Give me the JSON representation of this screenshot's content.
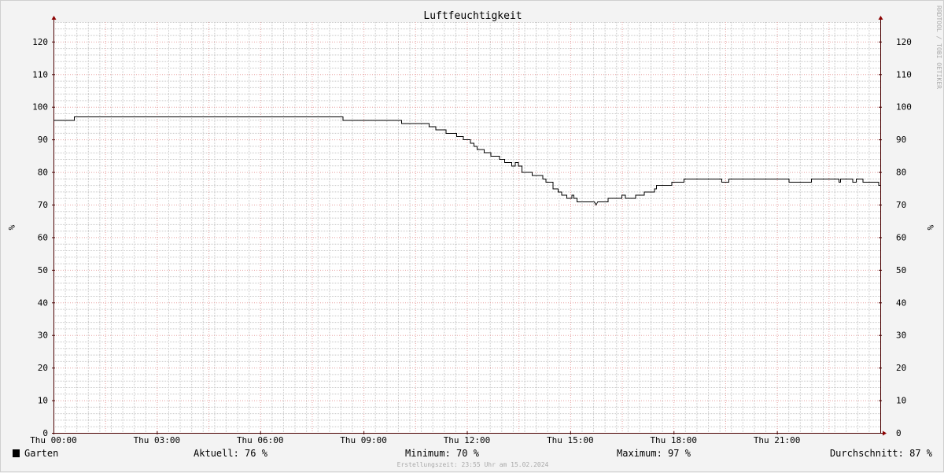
{
  "chart_data": {
    "type": "line",
    "title": "Luftfeuchtigkeit",
    "ylabel_left": "%",
    "ylabel_right": "%",
    "watermark": "RRDTOOL / TOBI OETIKER",
    "ylim": [
      0,
      126
    ],
    "y_ticks": [
      0,
      10,
      20,
      30,
      40,
      50,
      60,
      70,
      80,
      90,
      100,
      110,
      120
    ],
    "x_range_hours": [
      0,
      24
    ],
    "x_ticks": [
      {
        "hour": 0,
        "label": "Thu 00:00"
      },
      {
        "hour": 3,
        "label": "Thu 03:00"
      },
      {
        "hour": 6,
        "label": "Thu 06:00"
      },
      {
        "hour": 9,
        "label": "Thu 09:00"
      },
      {
        "hour": 12,
        "label": "Thu 12:00"
      },
      {
        "hour": 15,
        "label": "Thu 15:00"
      },
      {
        "hour": 18,
        "label": "Thu 18:00"
      },
      {
        "hour": 21,
        "label": "Thu 21:00"
      }
    ],
    "grid": true,
    "colors": {
      "background": "#f3f3f3",
      "canvas": "#ffffff",
      "major_grid": "#e8a0a0",
      "minor_grid": "#c8c8c8",
      "axis": "#4a0000",
      "line": "#000000"
    },
    "series": [
      {
        "name": "Garten",
        "color": "#000000",
        "points": [
          [
            0.0,
            96
          ],
          [
            0.6,
            96
          ],
          [
            0.6,
            97
          ],
          [
            8.4,
            97
          ],
          [
            8.4,
            96
          ],
          [
            10.1,
            96
          ],
          [
            10.1,
            95
          ],
          [
            10.9,
            95
          ],
          [
            10.9,
            94
          ],
          [
            11.1,
            94
          ],
          [
            11.1,
            93
          ],
          [
            11.4,
            93
          ],
          [
            11.4,
            92
          ],
          [
            11.7,
            92
          ],
          [
            11.7,
            91
          ],
          [
            11.9,
            91
          ],
          [
            11.9,
            90
          ],
          [
            12.1,
            90
          ],
          [
            12.1,
            89
          ],
          [
            12.2,
            89
          ],
          [
            12.2,
            88
          ],
          [
            12.3,
            88
          ],
          [
            12.3,
            87
          ],
          [
            12.5,
            87
          ],
          [
            12.5,
            86
          ],
          [
            12.7,
            86
          ],
          [
            12.7,
            85
          ],
          [
            12.95,
            85
          ],
          [
            12.95,
            84
          ],
          [
            13.1,
            84
          ],
          [
            13.1,
            83
          ],
          [
            13.3,
            83
          ],
          [
            13.3,
            82
          ],
          [
            13.4,
            82
          ],
          [
            13.4,
            83
          ],
          [
            13.5,
            83
          ],
          [
            13.5,
            82
          ],
          [
            13.6,
            82
          ],
          [
            13.6,
            80
          ],
          [
            13.9,
            80
          ],
          [
            13.9,
            79
          ],
          [
            14.2,
            79
          ],
          [
            14.2,
            78
          ],
          [
            14.3,
            78
          ],
          [
            14.3,
            77
          ],
          [
            14.5,
            77
          ],
          [
            14.5,
            75
          ],
          [
            14.65,
            75
          ],
          [
            14.65,
            74
          ],
          [
            14.75,
            74
          ],
          [
            14.75,
            73
          ],
          [
            14.9,
            73
          ],
          [
            14.9,
            72
          ],
          [
            15.05,
            72
          ],
          [
            15.05,
            73
          ],
          [
            15.1,
            73
          ],
          [
            15.1,
            72
          ],
          [
            15.2,
            72
          ],
          [
            15.2,
            71
          ],
          [
            15.7,
            71
          ],
          [
            15.75,
            70
          ],
          [
            15.8,
            71
          ],
          [
            16.1,
            71
          ],
          [
            16.1,
            72
          ],
          [
            16.5,
            72
          ],
          [
            16.5,
            73
          ],
          [
            16.6,
            73
          ],
          [
            16.6,
            72
          ],
          [
            16.9,
            72
          ],
          [
            16.9,
            73
          ],
          [
            17.15,
            73
          ],
          [
            17.15,
            74
          ],
          [
            17.45,
            74
          ],
          [
            17.45,
            75
          ],
          [
            17.5,
            75
          ],
          [
            17.5,
            76
          ],
          [
            17.95,
            76
          ],
          [
            17.95,
            77
          ],
          [
            18.3,
            77
          ],
          [
            18.3,
            78
          ],
          [
            19.4,
            78
          ],
          [
            19.4,
            77
          ],
          [
            19.6,
            77
          ],
          [
            19.6,
            78
          ],
          [
            21.35,
            78
          ],
          [
            21.35,
            77
          ],
          [
            22.0,
            77
          ],
          [
            22.0,
            78
          ],
          [
            22.8,
            78
          ],
          [
            22.8,
            77
          ],
          [
            22.85,
            77
          ],
          [
            22.85,
            78
          ],
          [
            23.2,
            78
          ],
          [
            23.2,
            77
          ],
          [
            23.3,
            77
          ],
          [
            23.3,
            78
          ],
          [
            23.5,
            78
          ],
          [
            23.5,
            77
          ],
          [
            23.95,
            77
          ],
          [
            23.95,
            76
          ],
          [
            24.0,
            76
          ]
        ]
      }
    ],
    "legend": {
      "series_label": "Garten",
      "stats": [
        {
          "label": "Aktuell:",
          "value": "76 %"
        },
        {
          "label": "Minimum:",
          "value": "70 %"
        },
        {
          "label": "Maximum:",
          "value": "97 %"
        },
        {
          "label": "Durchschnitt:",
          "value": "87 %"
        }
      ]
    },
    "footer": "Erstellungszeit: 23:55 Uhr am 15.02.2024"
  }
}
